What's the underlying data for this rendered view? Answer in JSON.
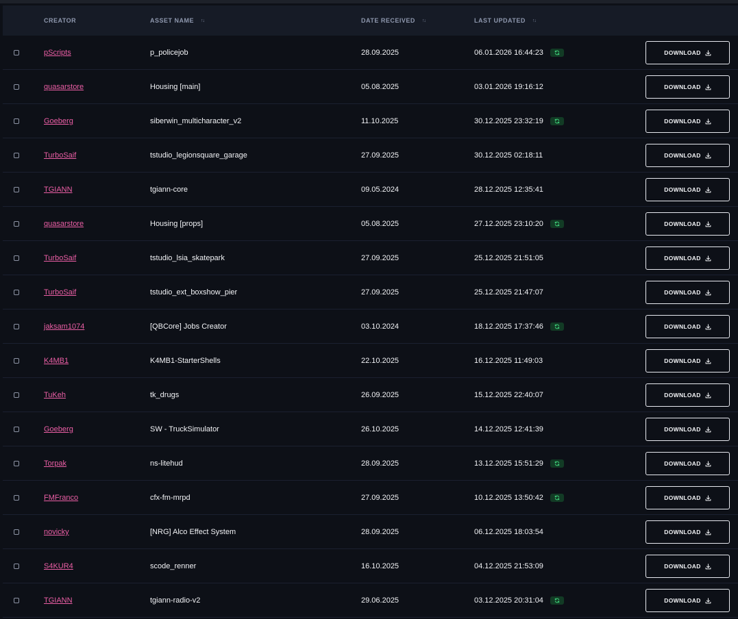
{
  "table": {
    "headers": {
      "creator": "CREATOR",
      "asset_name": "ASSET NAME",
      "date_received": "DATE RECEIVED",
      "last_updated": "LAST UPDATED"
    },
    "sort_icon": "sort-arrows-icon",
    "download_label": "DOWNLOAD",
    "download_icon": "download-icon",
    "sync_icon": "sync-icon",
    "colors": {
      "creator_link": "#ec5fa6",
      "sync_badge_bg": "#123b25",
      "sync_badge_fg": "#3fd07a",
      "header_bg": "#161b26",
      "page_bg": "#0d1017"
    },
    "rows": [
      {
        "creator": "pScripts",
        "asset": "p_policejob",
        "received": "28.09.2025",
        "updated": "06.01.2026 16:44:23",
        "sync": true
      },
      {
        "creator": "quasarstore",
        "asset": "Housing [main]",
        "received": "05.08.2025",
        "updated": "03.01.2026 19:16:12",
        "sync": false
      },
      {
        "creator": "Goeberg",
        "asset": "siberwin_multicharacter_v2",
        "received": "11.10.2025",
        "updated": "30.12.2025 23:32:19",
        "sync": true
      },
      {
        "creator": "TurboSaif",
        "asset": "tstudio_legionsquare_garage",
        "received": "27.09.2025",
        "updated": "30.12.2025 02:18:11",
        "sync": false
      },
      {
        "creator": "TGIANN",
        "asset": "tgiann-core",
        "received": "09.05.2024",
        "updated": "28.12.2025 12:35:41",
        "sync": false
      },
      {
        "creator": "quasarstore",
        "asset": "Housing [props]",
        "received": "05.08.2025",
        "updated": "27.12.2025 23:10:20",
        "sync": true
      },
      {
        "creator": "TurboSaif",
        "asset": "tstudio_lsia_skatepark",
        "received": "27.09.2025",
        "updated": "25.12.2025 21:51:05",
        "sync": false
      },
      {
        "creator": "TurboSaif",
        "asset": "tstudio_ext_boxshow_pier",
        "received": "27.09.2025",
        "updated": "25.12.2025 21:47:07",
        "sync": false
      },
      {
        "creator": "jaksam1074",
        "asset": "[QBCore] Jobs Creator",
        "received": "03.10.2024",
        "updated": "18.12.2025 17:37:46",
        "sync": true
      },
      {
        "creator": "K4MB1",
        "asset": "K4MB1-StarterShells",
        "received": "22.10.2025",
        "updated": "16.12.2025 11:49:03",
        "sync": false
      },
      {
        "creator": "TuKeh",
        "asset": "tk_drugs",
        "received": "26.09.2025",
        "updated": "15.12.2025 22:40:07",
        "sync": false
      },
      {
        "creator": "Goeberg",
        "asset": "SW - TruckSimulator",
        "received": "26.10.2025",
        "updated": "14.12.2025 12:41:39",
        "sync": false
      },
      {
        "creator": "Torpak",
        "asset": "ns-litehud",
        "received": "28.09.2025",
        "updated": "13.12.2025 15:51:29",
        "sync": true
      },
      {
        "creator": "FMFranco",
        "asset": "cfx-fm-mrpd",
        "received": "27.09.2025",
        "updated": "10.12.2025 13:50:42",
        "sync": true
      },
      {
        "creator": "novicky",
        "asset": "[NRG] Alco Effect System",
        "received": "28.09.2025",
        "updated": "06.12.2025 18:03:54",
        "sync": false
      },
      {
        "creator": "S4KUR4",
        "asset": "scode_renner",
        "received": "16.10.2025",
        "updated": "04.12.2025 21:53:09",
        "sync": false
      },
      {
        "creator": "TGIANN",
        "asset": "tgiann-radio-v2",
        "received": "29.06.2025",
        "updated": "03.12.2025 20:31:04",
        "sync": true
      }
    ]
  }
}
